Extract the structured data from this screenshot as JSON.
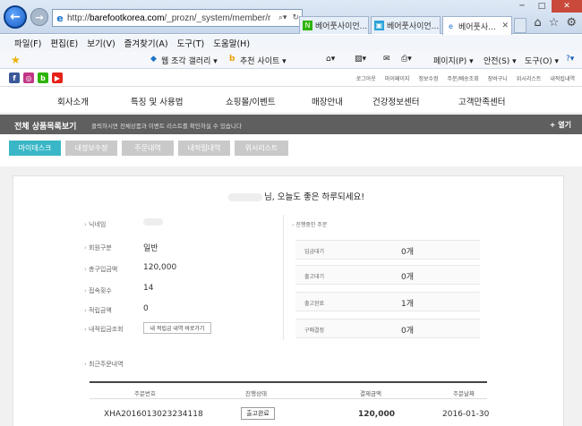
{
  "browser": {
    "url_prefix": "http://",
    "url_domain": "barefootkorea.com",
    "url_path": "/_prozn/_system/member/r",
    "tabs": [
      {
        "label": "베어풋사이언..."
      },
      {
        "label": "베어풋사이언..."
      },
      {
        "label": "베어풋사..."
      }
    ],
    "menu": [
      "파일(F)",
      "편집(E)",
      "보기(V)",
      "즐겨찾기(A)",
      "도구(T)",
      "도움말(H)"
    ],
    "cmd": {
      "gallery": "웹 조각 갤러리 ▾",
      "suggest": "추천 사이트 ▾",
      "page": "페이지(P) ▾",
      "safety": "안전(S) ▾",
      "tools": "도구(O) ▾"
    }
  },
  "site": {
    "util_links": [
      "로그아웃",
      "마이페이지",
      "정보수정",
      "주문/배송조회",
      "장바구니",
      "위시리스트",
      "내적립내역"
    ],
    "nav": [
      "회사소개",
      "특징 및 사용법",
      "쇼핑몰/이벤트",
      "매장안내",
      "건강정보센터",
      "고객만족센터"
    ],
    "product_bar": {
      "title": "전체 상품목록보기",
      "subtitle": "클릭하시면 전체상품과 이벤트 리스트를 확인하실 수 있습니다",
      "open": "+ 열기"
    },
    "subtabs": [
      "마이데스크",
      "내정보수정",
      "주문내역",
      "내적립내역",
      "위시리스트"
    ]
  },
  "mydesk": {
    "greeting": "님, 오늘도 좋은 하루되세요!",
    "fields": [
      {
        "label": "닉네임",
        "value": ""
      },
      {
        "label": "회원구분",
        "value": "일반"
      },
      {
        "label": "총구입금액",
        "value": "120,000"
      },
      {
        "label": "접속횟수",
        "value": "14"
      },
      {
        "label": "적립금액",
        "value": "0"
      },
      {
        "label": "내적립금조회",
        "value": ""
      }
    ],
    "history_button": "내 적립금 내역 바로가기",
    "progress_title": "진행중인 주문",
    "progress": [
      {
        "label": "입금대기",
        "value": "0개"
      },
      {
        "label": "출고대기",
        "value": "0개"
      },
      {
        "label": "출고완료",
        "value": "1개"
      },
      {
        "label": "구매결정",
        "value": "0개"
      }
    ],
    "recent_label": "최근주문내역",
    "order_headers": [
      "주문번호",
      "진행상태",
      "결제금액",
      "주문날짜"
    ],
    "orders": [
      {
        "no": "XHA2016013023234118",
        "status": "출고완료",
        "amount": "120,000",
        "date": "2016-01-30"
      }
    ]
  },
  "colors": {
    "accent": "#3ab7c7",
    "product_bar": "#5f5f5f",
    "tab_inactive": "#c9c9c9"
  }
}
